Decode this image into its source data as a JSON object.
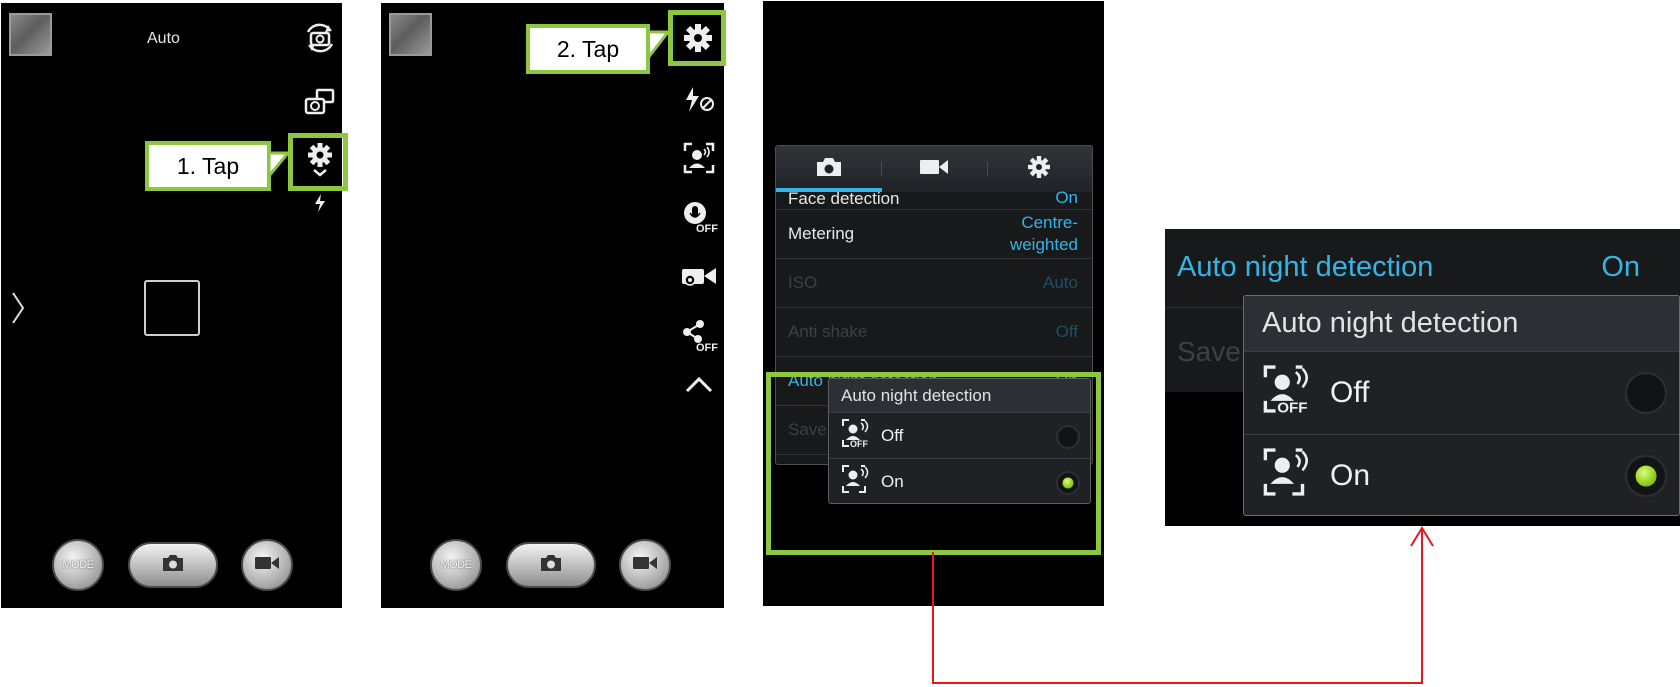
{
  "screen1": {
    "mode_label": "Auto",
    "callout": "1. Tap",
    "buttons": {
      "mode": "MODE"
    }
  },
  "screen2": {
    "callout": "2. Tap",
    "buttons": {
      "mode": "MODE"
    }
  },
  "screen3": {
    "tabs": [
      "camera-icon",
      "video-icon",
      "gear-icon"
    ],
    "rows": [
      {
        "label": "Face detection",
        "value": "On"
      },
      {
        "label": "Metering",
        "value_line1": "Centre-",
        "value_line2": "weighted"
      },
      {
        "label": "ISO",
        "value": "Auto"
      },
      {
        "label": "Anti shake",
        "value": "Off"
      },
      {
        "label": "Auto night detection",
        "value": "On"
      },
      {
        "label": "Save"
      }
    ],
    "popup": {
      "title": "Auto night detection",
      "options": [
        {
          "label": "Off",
          "selected": false
        },
        {
          "label": "On",
          "selected": true
        }
      ]
    }
  },
  "zoom": {
    "row_label": "Auto night detection",
    "row_value": "On",
    "save_partial": "Save",
    "popup": {
      "title": "Auto night detection",
      "options": [
        {
          "label": "Off",
          "selected": false
        },
        {
          "label": "On",
          "selected": true
        }
      ]
    }
  },
  "colors": {
    "highlight_green": "#8dc63f",
    "accent_blue": "#33b5e5",
    "connector_red": "#e8161d",
    "radio_on": "#8ccd1a"
  }
}
